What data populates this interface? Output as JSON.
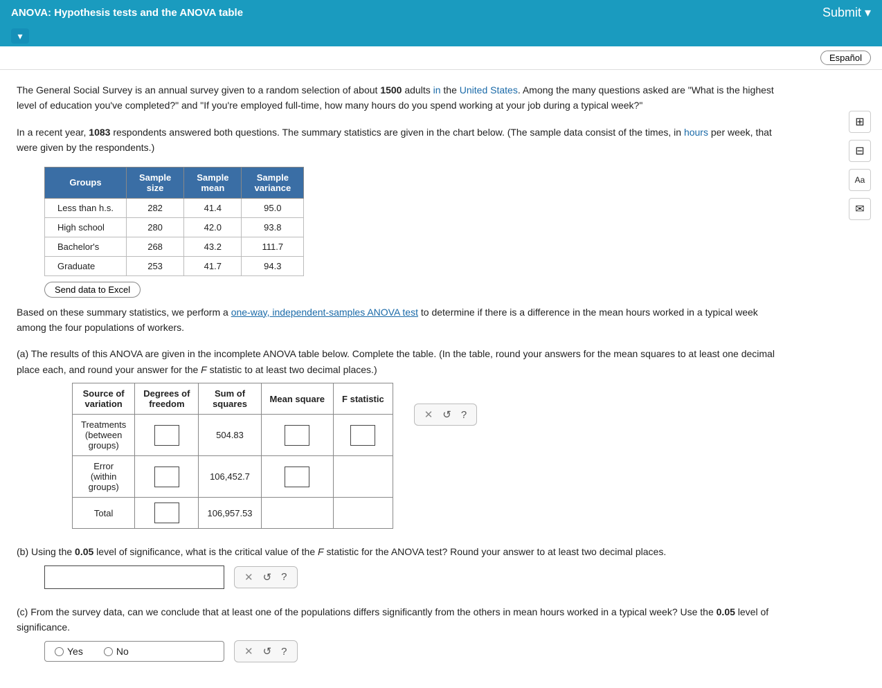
{
  "header": {
    "title": "ANOVA: Hypothesis tests and the ANOVA table",
    "espanol_label": "Español",
    "chevron": "▾"
  },
  "intro": {
    "paragraph1": "The General Social Survey is an annual survey given to a random selection of about 1500 adults in the United States. Among the many questions asked are \"What is the highest level of education you've completed?\" and \"If you're employed full-time, how many hours do you spend working at your job during a typical week?\"",
    "paragraph2": "In a recent year, 1083 respondents answered both questions. The summary statistics are given in the chart below. (The sample data consist of the times, in hours per week, that were given by the respondents.)"
  },
  "table": {
    "headers": [
      "Groups",
      "Sample size",
      "Sample mean",
      "Sample variance"
    ],
    "rows": [
      [
        "Less than h.s.",
        "282",
        "41.4",
        "95.0"
      ],
      [
        "High school",
        "280",
        "42.0",
        "93.8"
      ],
      [
        "Bachelor's",
        "268",
        "43.2",
        "111.7"
      ],
      [
        "Graduate",
        "253",
        "41.7",
        "94.3"
      ]
    ]
  },
  "send_excel_label": "Send data to Excel",
  "based_on_text_part1": "Based on these summary statistics, we perform a ",
  "link_text": "one-way, independent-samples ANOVA test",
  "based_on_text_part2": " to determine if there is a difference in the mean hours worked in a typical week among the four populations of workers.",
  "question_a": {
    "label": "(a) The results of this ANOVA are given in the incomplete ANOVA table below. Complete the table. (In the table, round your answers for the mean squares to at least one decimal place each, and round your answer for the F statistic to at least two decimal places.)",
    "anova_headers": [
      "Source of variation",
      "Degrees of freedom",
      "Sum of squares",
      "Mean square",
      "F statistic"
    ],
    "rows": [
      {
        "source": "Treatments\n(between\ngroups)",
        "df": "",
        "ss": "504.83",
        "ms": "",
        "f": ""
      },
      {
        "source": "Error\n(within\ngroups)",
        "df": "",
        "ss": "106,452.7",
        "ms": "",
        "f": ""
      },
      {
        "source": "Total",
        "df": "",
        "ss": "106,957.53",
        "ms": "",
        "f": ""
      }
    ]
  },
  "question_b": {
    "label": "(b) Using the 0.05 level of significance, what is the critical value of the F statistic for the ANOVA test? Round your answer to at least two decimal places."
  },
  "question_c": {
    "label": "(c) From the survey data, can we conclude that at least one of the populations differs significantly from the others in mean hours worked in a typical week? Use the 0.05 level of significance.",
    "yes_label": "Yes",
    "no_label": "No"
  },
  "action_buttons": {
    "x_symbol": "✕",
    "refresh_symbol": "↺",
    "question_symbol": "?"
  },
  "sidebar_icons": {
    "calculator": "▦",
    "table": "▤",
    "text": "Aa",
    "mail": "✉"
  }
}
